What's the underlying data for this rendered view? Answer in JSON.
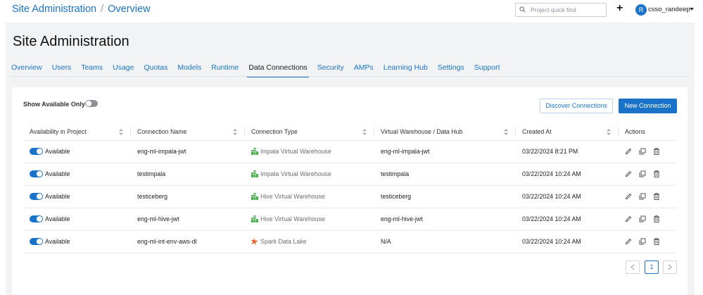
{
  "header": {
    "breadcrumb": [
      "Site Administration",
      "Overview"
    ],
    "search_placeholder": "Project quick find",
    "avatar_initial": "R",
    "username": "csso_randeep"
  },
  "page": {
    "title": "Site Administration",
    "tabs": [
      "Overview",
      "Users",
      "Teams",
      "Usage",
      "Quotas",
      "Models",
      "Runtime",
      "Data Connections",
      "Security",
      "AMPs",
      "Learning Hub",
      "Settings",
      "Support"
    ],
    "active_tab": "Data Connections"
  },
  "toolbar": {
    "show_available_label": "Show Available Only",
    "show_available_on": false,
    "discover_label": "Discover Connections",
    "new_label": "New Connection"
  },
  "table": {
    "columns": [
      "Availability in Project",
      "Connection Name",
      "Connection Type",
      "Virtual Warehouse / Data Hub",
      "Created At",
      "Actions"
    ],
    "rows": [
      {
        "availability": "Available",
        "name": "eng-ml-impala-jwt",
        "type": "Impala Virtual Warehouse",
        "type_icon": "warehouse-icon",
        "warehouse": "eng-ml-impala-jwt",
        "created": "03/22/2024 8:21 PM"
      },
      {
        "availability": "Available",
        "name": "testimpala",
        "type": "Impala Virtual Warehouse",
        "type_icon": "warehouse-icon",
        "warehouse": "testimpala",
        "created": "03/22/2024 10:24 AM"
      },
      {
        "availability": "Available",
        "name": "testiceberg",
        "type": "Hive Virtual Warehouse",
        "type_icon": "warehouse-icon",
        "warehouse": "testiceberg",
        "created": "03/22/2024 10:24 AM"
      },
      {
        "availability": "Available",
        "name": "eng-ml-hive-jwt",
        "type": "Hive Virtual Warehouse",
        "type_icon": "warehouse-icon",
        "warehouse": "eng-ml-hive-jwt",
        "created": "03/22/2024 10:24 AM"
      },
      {
        "availability": "Available",
        "name": "eng-ml-int-env-aws-dl",
        "type": "Spark Data Lake",
        "type_icon": "spark-icon",
        "warehouse": "N/A",
        "created": "03/22/2024 10:24 AM"
      }
    ]
  },
  "pagination": {
    "current_page": "1"
  },
  "colors": {
    "accent": "#1a73c8",
    "warehouse_green": "#4caf50",
    "spark_orange": "#e8642c"
  }
}
